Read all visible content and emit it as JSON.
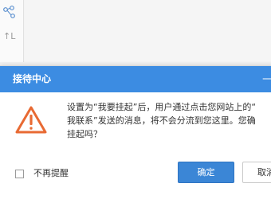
{
  "background": {
    "sidebar_icon_1": "nodes-icon",
    "sidebar_icon_2_text": "↑L"
  },
  "dialog": {
    "title": "接待中心",
    "close_glyph": "—",
    "icon": "warning-triangle-icon",
    "message_lines": [
      "设置为“我要挂起”后，用户通过点击您网站上的“",
      "我联系”发送的消息，将不会分流到您这里。您确",
      "挂起吗？"
    ],
    "checkbox": {
      "label": "不再提醒",
      "checked": false
    },
    "buttons": {
      "confirm": "确定",
      "cancel": "取消"
    }
  },
  "colors": {
    "header": "#3c8ce2",
    "primary_button": "#3b86d6",
    "warning": "#e86a33"
  }
}
